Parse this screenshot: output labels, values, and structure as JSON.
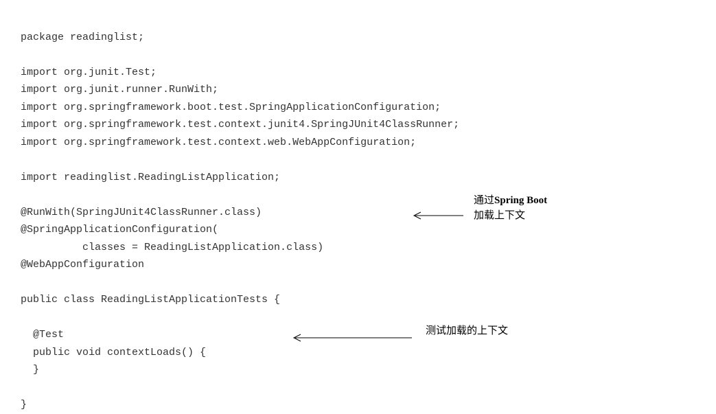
{
  "code": {
    "line1": "package readinglist;",
    "line2": "",
    "line3": "import org.junit.Test;",
    "line4": "import org.junit.runner.RunWith;",
    "line5": "import org.springframework.boot.test.SpringApplicationConfiguration;",
    "line6": "import org.springframework.test.context.junit4.SpringJUnit4ClassRunner;",
    "line7": "import org.springframework.test.context.web.WebAppConfiguration;",
    "line8": "",
    "line9": "import readinglist.ReadingListApplication;",
    "line10": "",
    "line11": "@RunWith(SpringJUnit4ClassRunner.class)",
    "line12": "@SpringApplicationConfiguration(",
    "line13": "          classes = ReadingListApplication.class)",
    "line14": "@WebAppConfiguration",
    "line15": "",
    "line16": "public class ReadingListApplicationTests {",
    "line17": "",
    "line18": "  @Test",
    "line19": "  public void contextLoads() {",
    "line20": "  }",
    "line21": "",
    "line22": "}"
  },
  "annotations": {
    "a1_prefix": "通过",
    "a1_bold": "Spring Boot",
    "a2": "加载上下文",
    "a3": "测试加载的上下文"
  }
}
